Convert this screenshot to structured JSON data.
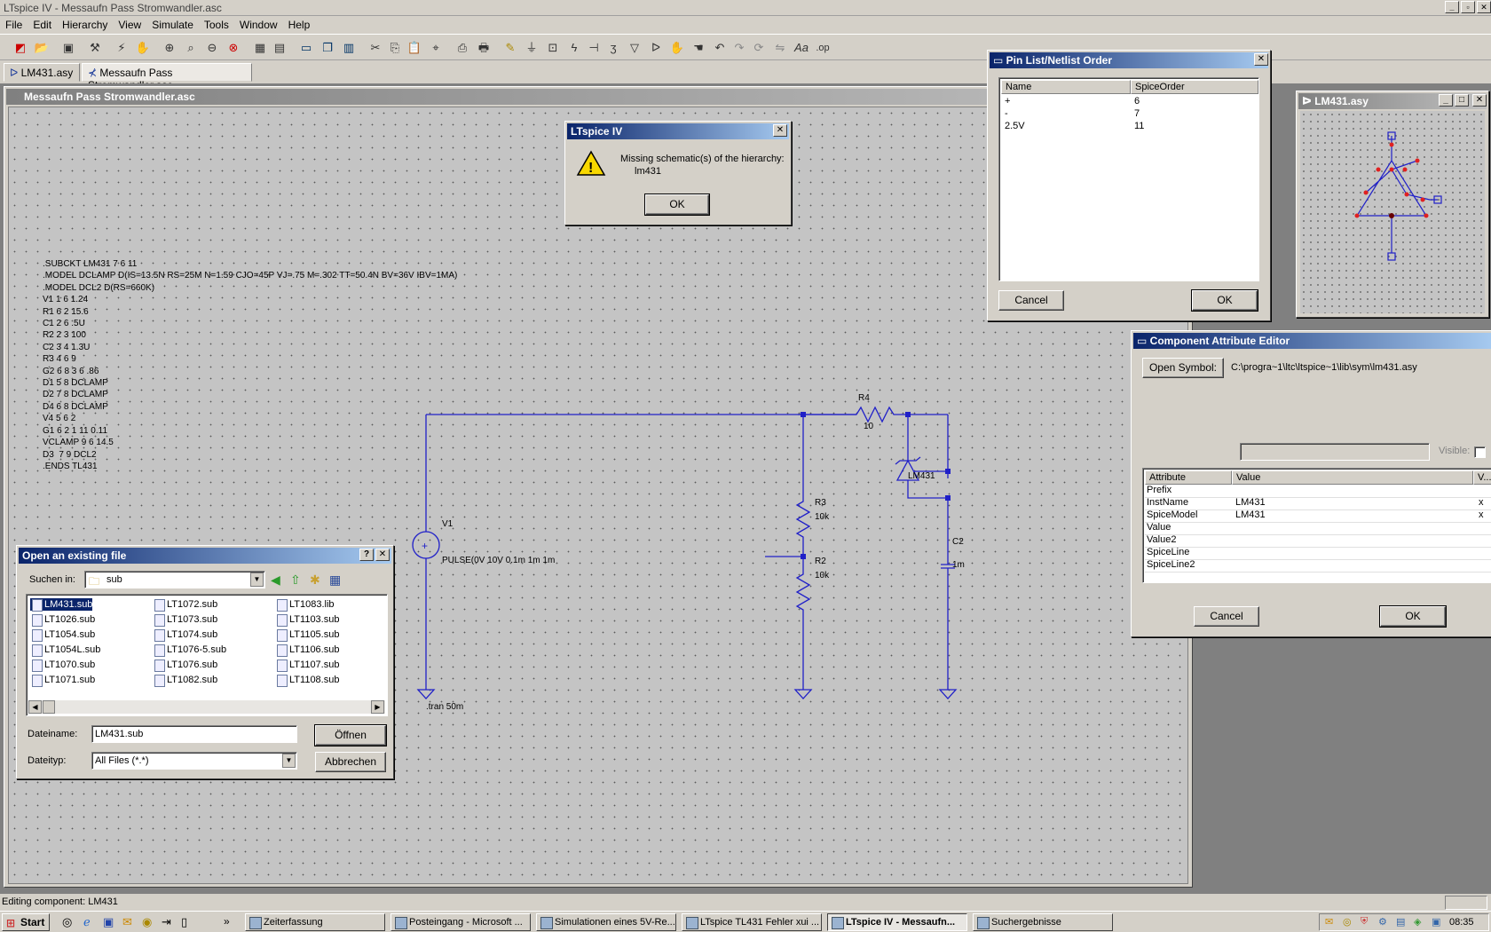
{
  "app": {
    "title": "LTspice IV - Messaufn Pass Stromwandler.asc",
    "menu": [
      "File",
      "Edit",
      "Hierarchy",
      "View",
      "Simulate",
      "Tools",
      "Window",
      "Help"
    ],
    "tabs": [
      "LM431.asy",
      "Messaufn Pass Stromwandler.asc"
    ]
  },
  "schematic": {
    "title": "Messaufn Pass Stromwandler.asc",
    "netlist": ".SUBCKT LM431 7 6 11\n.MODEL DCLAMP D(IS=13.5N RS=25M N=1.59 CJO=45P VJ=.75 M=.302 TT=50.4N BV=36V IBV=1MA)\n.MODEL DCL2 D(RS=660K)\nV1 1 6 1.24\nR1 6 2 15.6\nC1 2 6 .5U\nR2 2 3 100\nC2 3 4 1.3U\nR3 4 6 9\nG2 6 8 3 6 .86\nD1 5 8 DCLAMP\nD2 7 8 DCLAMP\nD4 6 8 DCLAMP\nV4 5 6 2\nG1 6 2 1 11 0.11\nVCLAMP 9 6 14.5\nD3  7 9 DCL2\n.ENDS TL431",
    "labels": {
      "r4": "R4",
      "r4_val": "10",
      "v1": "V1",
      "v1_val": "PULSE(0V 10V 0.1m 1m 1m",
      "r3": "R3",
      "r3_val": "10k",
      "r2": "R2",
      "r2_val": "10k",
      "c2": "C2",
      "c2_val": "1m",
      "u1": "LM431",
      "tran": ".tran 50m"
    }
  },
  "msgbox": {
    "title": "LTspice IV",
    "line1": "Missing schematic(s) of the hierarchy:",
    "line2": "lm431",
    "ok": "OK"
  },
  "pinlist": {
    "title": "Pin List/Netlist Order",
    "headers": [
      "Name",
      "SpiceOrder"
    ],
    "rows": [
      [
        "+",
        "6"
      ],
      [
        "-",
        "7"
      ],
      [
        "2.5V",
        "11"
      ]
    ],
    "cancel": "Cancel",
    "ok": "OK"
  },
  "symwin": {
    "title": "LM431.asy"
  },
  "attr": {
    "title": "Component Attribute Editor",
    "open_symbol": "Open Symbol:",
    "path": "C:\\progra~1\\ltc\\ltspice~1\\lib\\sym\\lm431.asy",
    "visible": "Visible:",
    "headers": [
      "Attribute",
      "Value",
      "V..."
    ],
    "rows": [
      [
        "Prefix",
        "",
        ""
      ],
      [
        "InstName",
        "LM431",
        "x"
      ],
      [
        "SpiceModel",
        "LM431",
        "x"
      ],
      [
        "Value",
        "",
        ""
      ],
      [
        "Value2",
        "",
        ""
      ],
      [
        "SpiceLine",
        "",
        ""
      ],
      [
        "SpiceLine2",
        "",
        ""
      ]
    ],
    "cancel": "Cancel",
    "ok": "OK"
  },
  "opendlg": {
    "title": "Open an existing file",
    "look_in_label": "Suchen in:",
    "look_in_value": "sub",
    "files": [
      "LM431.sub",
      "LT1026.sub",
      "LT1054.sub",
      "LT1054L.sub",
      "LT1070.sub",
      "LT1071.sub",
      "LT1072.sub",
      "LT1073.sub",
      "LT1074.sub",
      "LT1076-5.sub",
      "LT1076.sub",
      "LT1082.sub",
      "LT1083.lib",
      "LT1103.sub",
      "LT1105.sub",
      "LT1106.sub",
      "LT1107.sub",
      "LT1108.sub"
    ],
    "filename_label": "Dateiname:",
    "filename_value": "LM431.sub",
    "filetype_label": "Dateityp:",
    "filetype_value": "All Files (*.*)",
    "open": "Öffnen",
    "cancel": "Abbrechen"
  },
  "status": "Editing component: LM431",
  "taskbar": {
    "start": "Start",
    "tasks": [
      "Zeiterfassung",
      "Posteingang - Microsoft ...",
      "Simulationen eines 5V-Re...",
      "LTspice TL431 Fehler xui ...",
      "LTspice IV - Messaufn...",
      "Suchergebnisse"
    ],
    "clock": "08:35"
  }
}
